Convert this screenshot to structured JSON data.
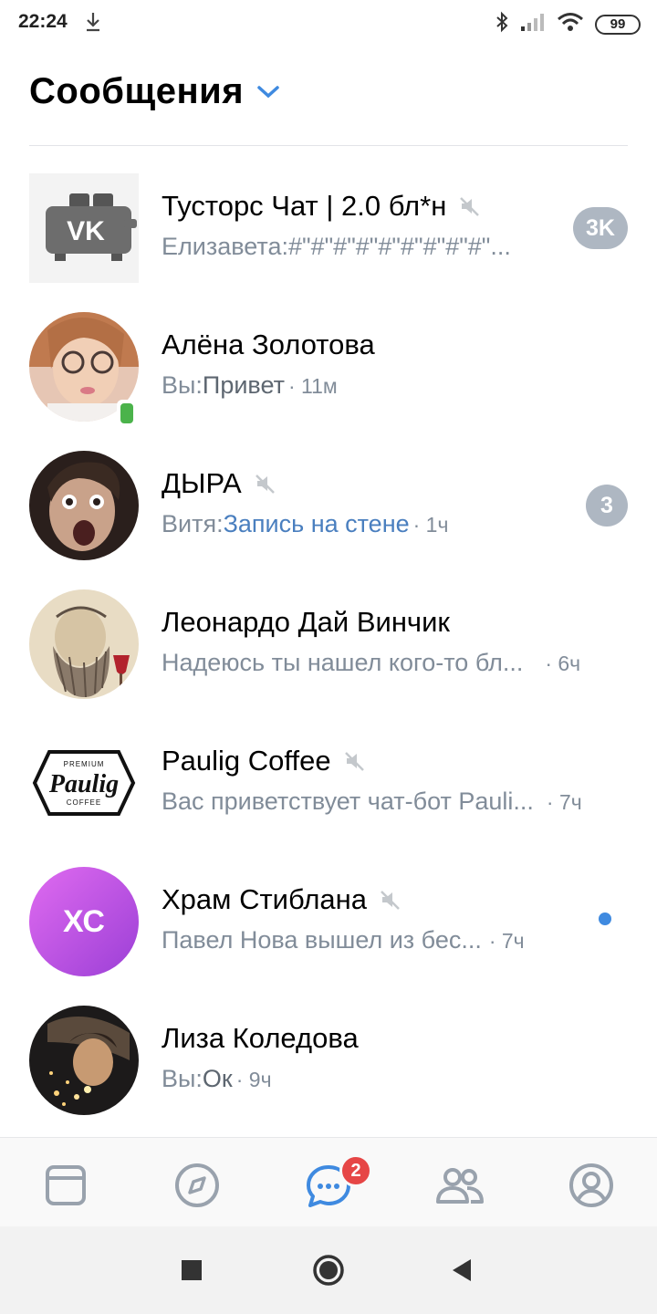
{
  "status_bar": {
    "time": "22:24",
    "battery": "99",
    "icons": [
      "download-icon",
      "bluetooth-icon",
      "signal-icon",
      "wifi-icon",
      "battery-icon"
    ]
  },
  "header": {
    "title": "Сообщения",
    "accent_color": "#3f8ae0"
  },
  "chats": [
    {
      "name": "Тусторс Чат | 2.0 бл*н",
      "muted": true,
      "author": "Елизавета: ",
      "text": "#\"#\"#\"#\"#\"#\"#\"#\"#\"...",
      "time": "",
      "badge": "3K",
      "avatar": "vk-toaster"
    },
    {
      "name": "Алёна Золотова",
      "muted": false,
      "author": "Вы: ",
      "text": "Привет",
      "time": "· 11м",
      "badge": "",
      "online_mobile": true,
      "avatar": "photo"
    },
    {
      "name": "ДЫРА",
      "muted": true,
      "author": "Витя: ",
      "text": "Запись на стене",
      "time": "· 1ч",
      "badge": "3",
      "avatar": "photo"
    },
    {
      "name": "Леонардо Дай Винчик",
      "muted": false,
      "author": "",
      "text": "Надеюсь ты нашел кого-то бл...",
      "time": "· 6ч",
      "badge": "",
      "avatar": "drawing"
    },
    {
      "name": "Paulig Coffee",
      "muted": true,
      "author": "",
      "text": "Вас приветствует чат-бот Pauli...",
      "time": "· 7ч",
      "badge": "",
      "avatar": "paulig-logo",
      "logo_text": {
        "top": "PREMIUM",
        "main": "Paulig",
        "bottom": "COFFEE"
      }
    },
    {
      "name": "Храм Стиблана",
      "muted": true,
      "author": "",
      "text": "Павел Нова вышел из бес...",
      "time": "· 7ч",
      "badge": "",
      "unread_dot": true,
      "avatar": "initials",
      "initials": "ХС"
    },
    {
      "name": "Лиза Коледова",
      "muted": false,
      "author": "Вы: ",
      "text": "Ок",
      "time": "· 9ч",
      "badge": "",
      "avatar": "photo"
    }
  ],
  "bottom_nav": {
    "items": [
      "news-icon",
      "discover-icon",
      "messages-icon",
      "friends-icon",
      "profile-icon"
    ],
    "active": "messages-icon",
    "messages_badge": "2"
  },
  "system_nav": [
    "recents-square-icon",
    "home-circle-icon",
    "back-triangle-icon"
  ]
}
